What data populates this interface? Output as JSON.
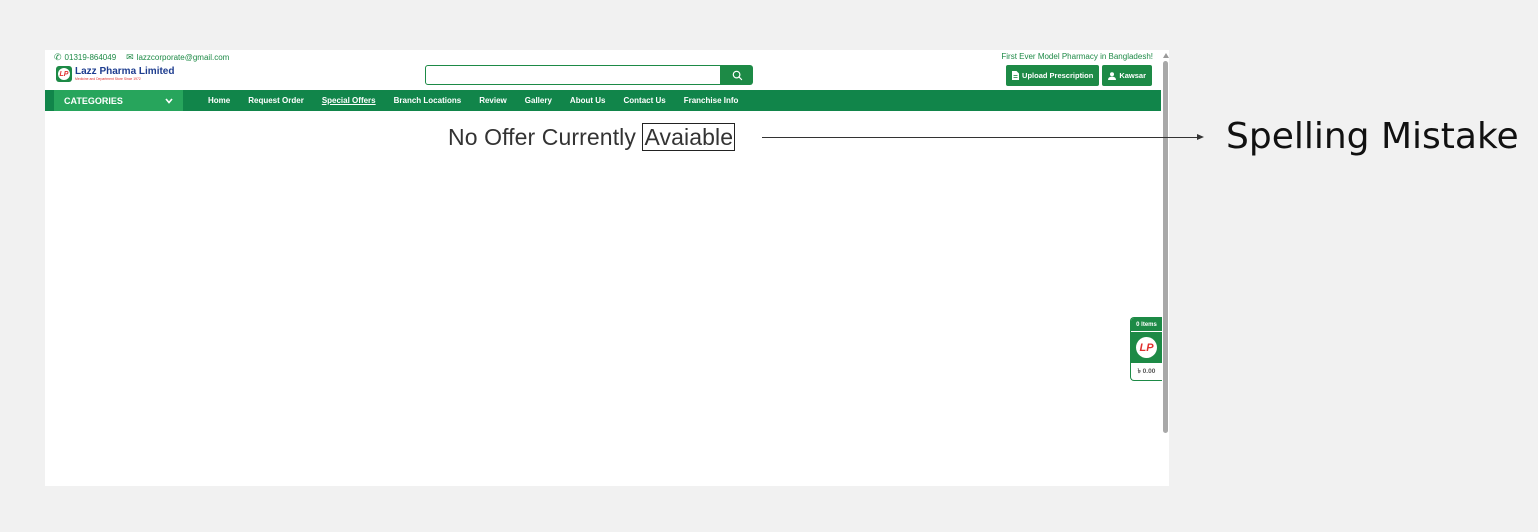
{
  "header": {
    "phone": "01319-864049",
    "email": "lazzcorporate@gmail.com",
    "tagline": "First Ever Model Pharmacy in Bangladesh!",
    "logo_name": "Lazz Pharma Limited",
    "logo_subtitle": "Medicine and Department Store Since 1972",
    "logo_initials": "LP",
    "upload_button": "Upload Prescription",
    "user_button": "Kawsar"
  },
  "search": {
    "value": "",
    "placeholder": ""
  },
  "nav": {
    "categories_label": "CATEGORIES",
    "links": [
      "Home",
      "Request Order",
      "Special Offers",
      "Branch Locations",
      "Review",
      "Gallery",
      "About Us",
      "Contact Us",
      "Franchise Info"
    ],
    "active": "Special Offers"
  },
  "main": {
    "message_prefix": "No Offer Currently ",
    "message_highlight": "Avaiable"
  },
  "cart": {
    "items_label": "0 Items",
    "total": "৳ 0.00"
  },
  "annotation": {
    "label": "Spelling Mistake"
  },
  "colors": {
    "primary_green": "#11854a",
    "category_green": "#27a55c",
    "brand_red": "#e0312f",
    "logo_blue": "#1e3d8f"
  }
}
